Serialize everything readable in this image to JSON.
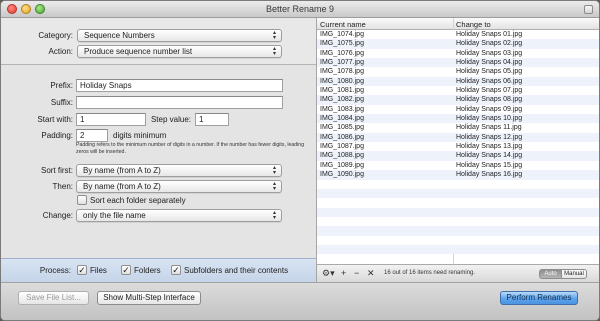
{
  "window": {
    "title": "Better Rename 9"
  },
  "settings": {
    "category_label": "Category:",
    "category_value": "Sequence Numbers",
    "action_label": "Action:",
    "action_value": "Produce sequence number list",
    "prefix_label": "Prefix:",
    "prefix_value": "Holiday Snaps",
    "suffix_label": "Suffix:",
    "suffix_value": "",
    "start_label": "Start with:",
    "start_value": "1",
    "step_label": "Step value:",
    "step_value": "1",
    "padding_label": "Padding:",
    "padding_value": "2",
    "padding_unit": "digits minimum",
    "padding_note": "Padding refers to the minimum number of digits in a number. If the number has fewer digits, leading zeros will be inserted.",
    "sort_first_label": "Sort first:",
    "sort_first_value": "By name (from A to Z)",
    "then_label": "Then:",
    "then_value": "By name (from A to Z)",
    "sort_each_label": "Sort each folder separately",
    "change_label": "Change:",
    "change_value": "only the file name"
  },
  "process": {
    "label": "Process:",
    "files_label": "Files",
    "folders_label": "Folders",
    "subfolders_label": "Subfolders and their contents"
  },
  "file_list": {
    "columns": [
      "Current name",
      "Change to"
    ],
    "rows": [
      [
        "IMG_1074.jpg",
        "Holiday Snaps 01.jpg"
      ],
      [
        "IMG_1075.jpg",
        "Holiday Snaps 02.jpg"
      ],
      [
        "IMG_1076.jpg",
        "Holiday Snaps 03.jpg"
      ],
      [
        "IMG_1077.jpg",
        "Holiday Snaps 04.jpg"
      ],
      [
        "IMG_1078.jpg",
        "Holiday Snaps 05.jpg"
      ],
      [
        "IMG_1080.jpg",
        "Holiday Snaps 06.jpg"
      ],
      [
        "IMG_1081.jpg",
        "Holiday Snaps 07.jpg"
      ],
      [
        "IMG_1082.jpg",
        "Holiday Snaps 08.jpg"
      ],
      [
        "IMG_1083.jpg",
        "Holiday Snaps 09.jpg"
      ],
      [
        "IMG_1084.jpg",
        "Holiday Snaps 10.jpg"
      ],
      [
        "IMG_1085.jpg",
        "Holiday Snaps 11.jpg"
      ],
      [
        "IMG_1086.jpg",
        "Holiday Snaps 12.jpg"
      ],
      [
        "IMG_1087.jpg",
        "Holiday Snaps 13.jpg"
      ],
      [
        "IMG_1088.jpg",
        "Holiday Snaps 14.jpg"
      ],
      [
        "IMG_1089.jpg",
        "Holiday Snaps 15.jpg"
      ],
      [
        "IMG_1090.jpg",
        "Holiday Snaps 16.jpg"
      ],
      [
        "",
        ""
      ],
      [
        "",
        ""
      ],
      [
        "",
        ""
      ],
      [
        "",
        ""
      ],
      [
        "",
        ""
      ],
      [
        "",
        ""
      ],
      [
        "",
        ""
      ],
      [
        "",
        ""
      ]
    ],
    "status": "16 out of 16 items need renaming.",
    "mode_auto": "Auto",
    "mode_manual": "Manual"
  },
  "buttons": {
    "save_file_list": "Save File List...",
    "show_multistep": "Show Multi-Step Interface",
    "perform_renames": "Perform Renames"
  }
}
